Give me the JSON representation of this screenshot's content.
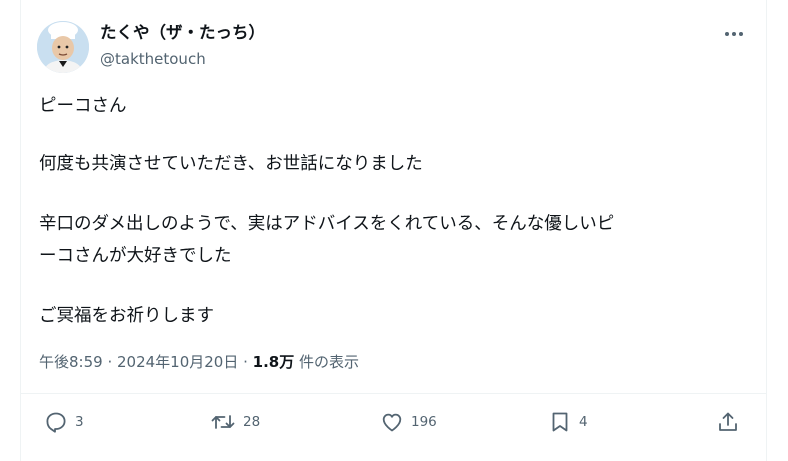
{
  "author": {
    "display_name": "たくや（ザ・たっち）",
    "handle": "@takthetouch",
    "avatar_icon": "user-avatar"
  },
  "tweet": {
    "lines": {
      "l1": "ピーコさん",
      "l2": "何度も共演させていただき、お世話になりました",
      "l3": "辛口のダメ出しのようで、実はアドバイスをくれている、そんな優しいピ",
      "l4": "ーコさんが大好きでした",
      "l5": "ご冥福をお祈りします"
    }
  },
  "meta": {
    "time": "午後8:59",
    "sep1": " · ",
    "date": "2024年10月20日",
    "sep2": " · ",
    "views": "1.8万",
    "views_label": " 件の表示"
  },
  "actions": {
    "reply_count": "3",
    "retweet_count": "28",
    "like_count": "196",
    "bookmark_count": "4"
  },
  "colors": {
    "text": "#0f1419",
    "secondary": "#536471",
    "border": "#eff3f4"
  }
}
